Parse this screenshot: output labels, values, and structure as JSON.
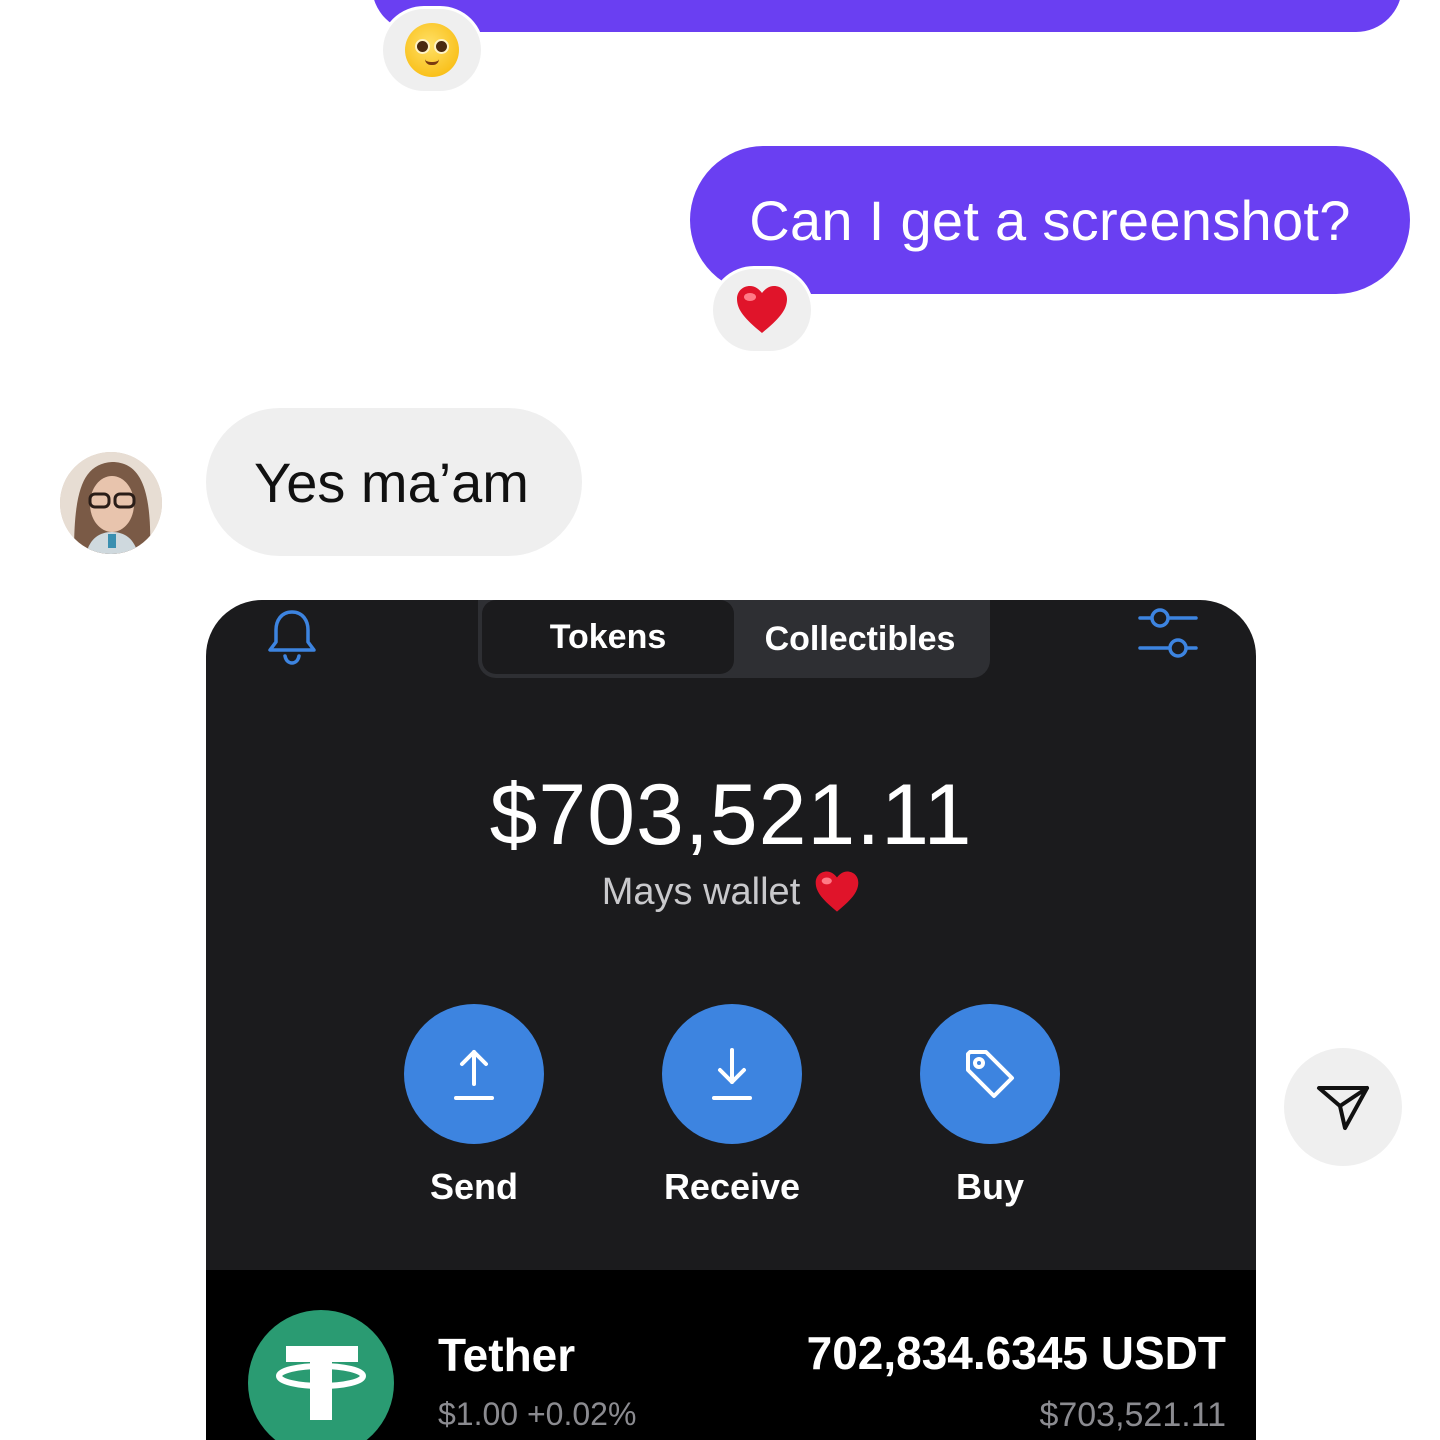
{
  "conversation": {
    "reaction_top": {
      "emoji": "pleading-face-emoji"
    },
    "outgoing_message": "Can I get a screenshot?",
    "reaction_outgoing": {
      "emoji": "red-heart-emoji"
    },
    "incoming_message": "Yes ma’am",
    "send_icon": "send-icon"
  },
  "wallet_screenshot": {
    "tabs": [
      {
        "label": "Tokens",
        "active": true
      },
      {
        "label": "Collectibles",
        "active": false
      }
    ],
    "bell_icon": "bell-icon",
    "filter_icon": "filter-icon",
    "balance": "$703,521.11",
    "wallet_name": "Mays wallet",
    "actions": [
      {
        "label": "Send",
        "icon": "send-arrow-icon"
      },
      {
        "label": "Receive",
        "icon": "receive-arrow-icon"
      },
      {
        "label": "Buy",
        "icon": "tag-icon"
      }
    ],
    "token": {
      "name": "Tether",
      "price": "$1.00",
      "change": "+0.02%",
      "amount": "702,834.6345 USDT",
      "value": "$703,521.11"
    }
  },
  "colors": {
    "outgoing_bubble": "#6a3ff2",
    "incoming_bubble": "#efefef",
    "wallet_bg": "#1b1b1d",
    "action_button": "#3d84e0",
    "tether": "#2a9b72"
  }
}
